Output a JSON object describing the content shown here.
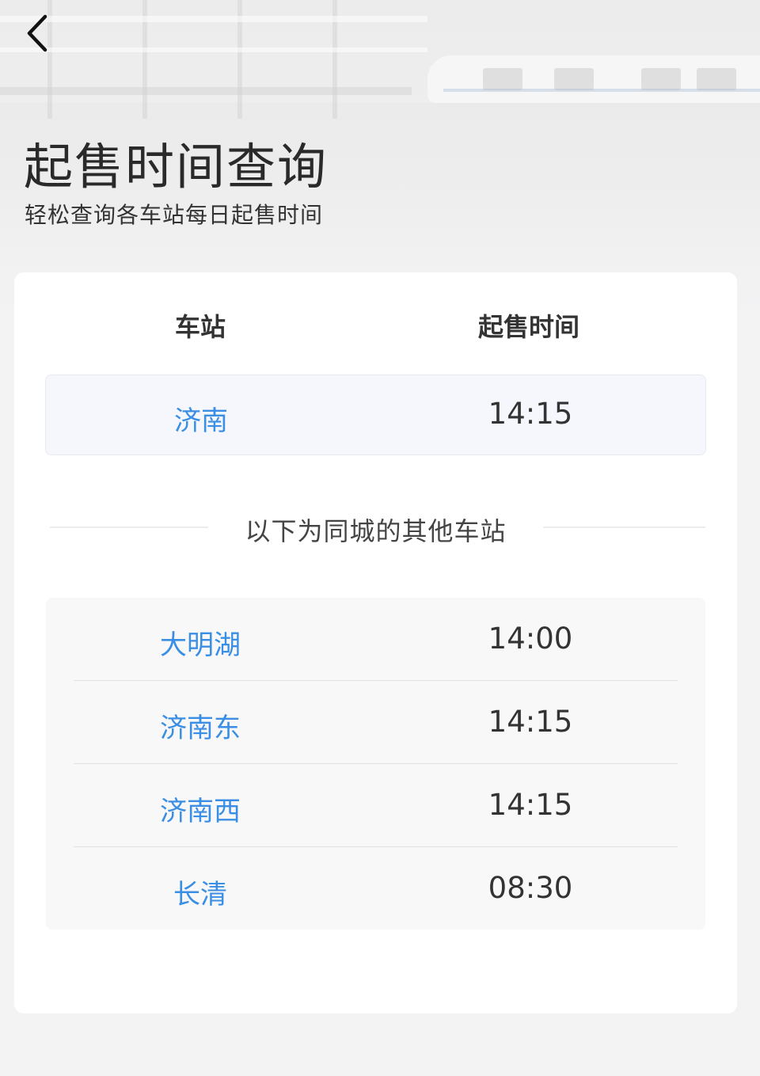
{
  "header": {
    "title": "起售时间查询",
    "subtitle": "轻松查询各车站每日起售时间"
  },
  "table": {
    "col_station": "车站",
    "col_time": "起售时间",
    "current": {
      "station": "济南",
      "time": "14:15"
    }
  },
  "divider": {
    "label": "以下为同城的其他车站"
  },
  "others": [
    {
      "station": "大明湖",
      "time": "14:00"
    },
    {
      "station": "济南东",
      "time": "14:15"
    },
    {
      "station": "济南西",
      "time": "14:15"
    },
    {
      "station": "长清",
      "time": "08:30"
    }
  ],
  "colors": {
    "accent": "#3a8ee3",
    "text": "#333333",
    "highlight_row": "#f5f7fc"
  }
}
